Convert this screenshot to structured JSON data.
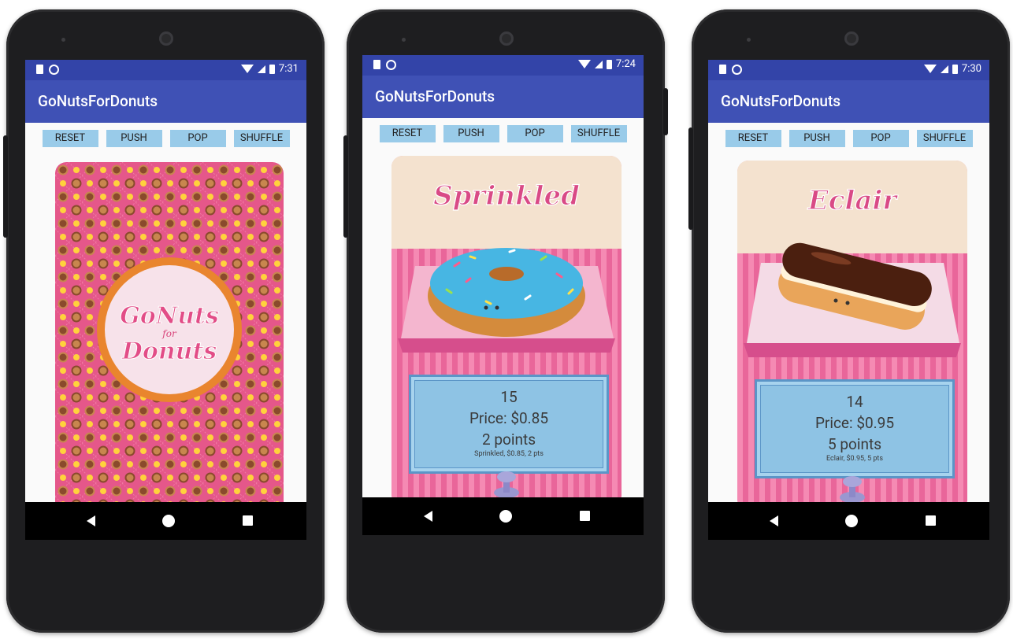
{
  "phones": [
    {
      "status_time": "7:31",
      "app_title": "GoNutsForDonuts",
      "buttons": [
        "RESET",
        "PUSH",
        "POP",
        "SHUFFLE"
      ],
      "card_type": "back",
      "logo": [
        "GoNuts",
        "for",
        "Donuts"
      ]
    },
    {
      "status_time": "7:24",
      "app_title": "GoNutsForDonuts",
      "buttons": [
        "RESET",
        "PUSH",
        "POP",
        "SHUFFLE"
      ],
      "card_type": "front",
      "donut_name": "Sprinkled",
      "donut_id": "15",
      "price": "Price: $0.85",
      "points": "2 points",
      "summary": "Sprinkled, $0.85, 2 pts"
    },
    {
      "status_time": "7:30",
      "app_title": "GoNutsForDonuts",
      "buttons": [
        "RESET",
        "PUSH",
        "POP",
        "SHUFFLE"
      ],
      "card_type": "front",
      "donut_name": "Eclair",
      "donut_id": "14",
      "price": "Price: $0.95",
      "points": "5 points",
      "summary": "Eclair, $0.95, 5 pts"
    }
  ],
  "colors": {
    "status_bar": "#3344a8",
    "app_bar": "#3f51b5",
    "button_bg": "#99cbe9",
    "card_pink": "#e6578a",
    "card_cream": "#f4e2cf",
    "info_box": "#8ec3e4"
  }
}
